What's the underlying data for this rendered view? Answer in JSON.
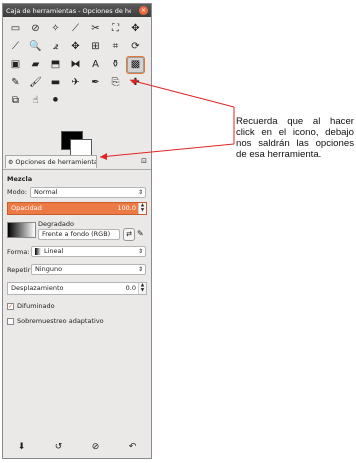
{
  "window": {
    "title": "Caja de herramientas - Opciones de herr…",
    "close_glyph": "×"
  },
  "toolbox": {
    "tools": [
      {
        "icon": "rect-select-icon",
        "glyph": "▭"
      },
      {
        "icon": "lasso-select-icon",
        "glyph": "⊘"
      },
      {
        "icon": "fuzzy-select-icon",
        "glyph": "✧"
      },
      {
        "icon": "magic-wand-icon",
        "glyph": "⟋"
      },
      {
        "icon": "scissors-select-icon",
        "glyph": "✂"
      },
      {
        "icon": "paths-select-icon",
        "glyph": "⛶"
      },
      {
        "icon": "move-icon",
        "glyph": "✥"
      },
      {
        "icon": "color-picker-icon",
        "glyph": "⟋"
      },
      {
        "icon": "zoom-icon",
        "glyph": "🔍"
      },
      {
        "icon": "measure-icon",
        "glyph": "⦨"
      },
      {
        "icon": "move-tool-icon",
        "glyph": "✥"
      },
      {
        "icon": "align-icon",
        "glyph": "⊞"
      },
      {
        "icon": "crop-icon",
        "glyph": "⌗"
      },
      {
        "icon": "rotate-icon",
        "glyph": "⟳"
      },
      {
        "icon": "scale-icon",
        "glyph": "▣"
      },
      {
        "icon": "shear-icon",
        "glyph": "▰"
      },
      {
        "icon": "perspective-icon",
        "glyph": "⬒"
      },
      {
        "icon": "flip-icon",
        "glyph": "⧓"
      },
      {
        "icon": "text-icon",
        "glyph": "A"
      },
      {
        "icon": "bucket-fill-icon",
        "glyph": "⚱"
      },
      {
        "icon": "blend-icon",
        "glyph": "▩"
      },
      {
        "icon": "pencil-icon",
        "glyph": "✎"
      },
      {
        "icon": "paintbrush-icon",
        "glyph": "🖌"
      },
      {
        "icon": "eraser-icon",
        "glyph": "▬"
      },
      {
        "icon": "airbrush-icon",
        "glyph": "✈"
      },
      {
        "icon": "ink-icon",
        "glyph": "✒"
      },
      {
        "icon": "clone-icon",
        "glyph": "⎘"
      },
      {
        "icon": "heal-icon",
        "glyph": "✚"
      },
      {
        "icon": "perspective-clone-icon",
        "glyph": "⧉"
      },
      {
        "icon": "smudge-icon",
        "glyph": "☝"
      },
      {
        "icon": "dodge-burn-icon",
        "glyph": "⚫"
      }
    ],
    "selected_index": 20
  },
  "tab": {
    "icon": "tool-options-icon",
    "label": "Opciones de herramienta"
  },
  "options": {
    "section_label": "Mezcla",
    "mode_label": "Modo:",
    "mode_value": "Normal",
    "opacity_label": "Opacidad",
    "opacity_value": "100.0",
    "gradient_label": "Degradado",
    "gradient_value": "Frente a fondo (RGB)",
    "shape_label": "Forma:",
    "shape_value": "Lineal",
    "repeat_label": "Repetir:",
    "repeat_value": "Ninguno",
    "offset_label": "Desplazamiento",
    "offset_value": "0.0",
    "dither_label": "Difuminado",
    "dither_checked": true,
    "adaptive_label": "Sobremuestreo adaptativo",
    "adaptive_checked": false
  },
  "bottom_buttons": [
    {
      "icon": "save-options-icon",
      "glyph": "⬇"
    },
    {
      "icon": "restore-options-icon",
      "glyph": "↺"
    },
    {
      "icon": "delete-options-icon",
      "glyph": "⊘"
    },
    {
      "icon": "reset-options-icon",
      "glyph": "↶"
    }
  ],
  "annotation": {
    "text": "Recuerda que al hacer click en el icono, debajo nos saldrán las opciones de esa herramienta."
  },
  "colors": {
    "accent": "#e8703a",
    "arrow": "#e02424",
    "opacity_fill": "#ec7a45"
  }
}
